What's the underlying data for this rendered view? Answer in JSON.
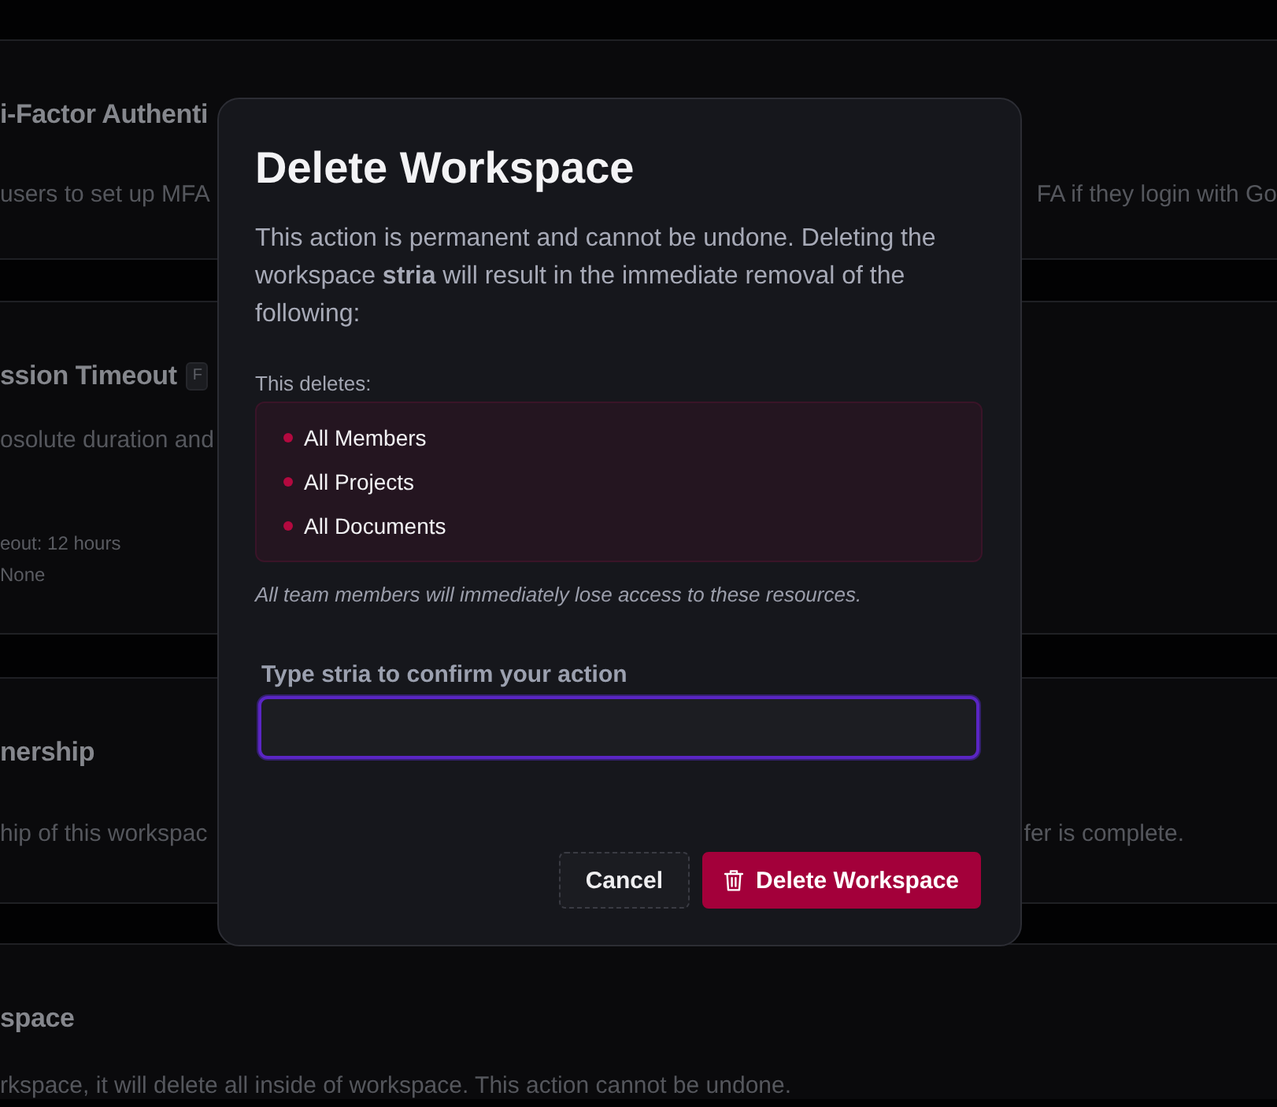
{
  "settings_sections": [
    {
      "title": "i-Factor Authenti",
      "description_left": "users to set up MFA",
      "description_right": "FA if they login with Go"
    },
    {
      "title": "ssion Timeout",
      "badge": "F",
      "description_left": "osolute duration and",
      "details": [
        "eout: 12 hours",
        "None"
      ]
    },
    {
      "title": "nership",
      "description_left": "hip of this workspac",
      "description_right": "fer is complete."
    },
    {
      "title": "space",
      "description_left": "rkspace, it will delete all inside of workspace. This action cannot be undone."
    }
  ],
  "dialog": {
    "title": "Delete Workspace",
    "message": "This action is permanent and cannot be undone. Deleting the workspace **stria** will result in the immediate removal of the following:",
    "deletes_label": "This deletes:",
    "deletes_items": [
      "All Members",
      "All Projects",
      "All Documents"
    ],
    "note": "All team members will immediately lose access to these resources.",
    "confirm_label": "Type **stria** to confirm your action",
    "confirm_field": {
      "focused": true
    },
    "buttons": [
      {
        "label": "Cancel",
        "kind": "secondary"
      },
      {
        "label": "Delete Workspace",
        "kind": "danger"
      }
    ]
  }
}
